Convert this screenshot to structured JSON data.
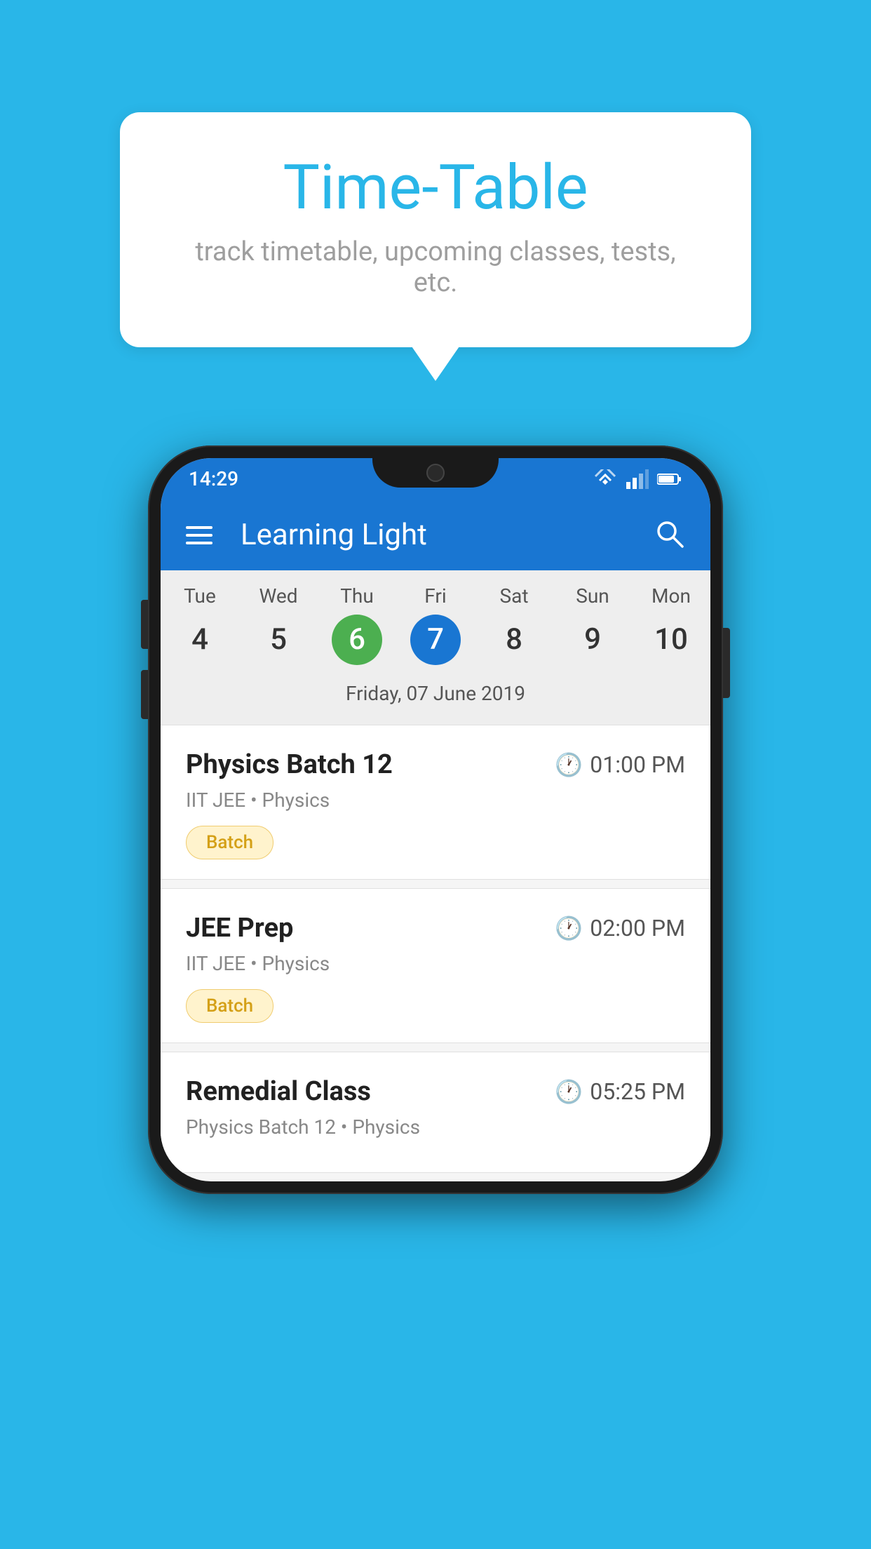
{
  "background_color": "#29B6E8",
  "tooltip": {
    "title": "Time-Table",
    "subtitle": "track timetable, upcoming classes, tests, etc."
  },
  "phone": {
    "status_bar": {
      "time": "14:29"
    },
    "app_bar": {
      "title": "Learning Light"
    },
    "calendar": {
      "days": [
        "Tue",
        "Wed",
        "Thu",
        "Fri",
        "Sat",
        "Sun",
        "Mon"
      ],
      "dates": [
        "4",
        "5",
        "6",
        "7",
        "8",
        "9",
        "10"
      ],
      "today_index": 2,
      "selected_index": 3,
      "selected_date_label": "Friday, 07 June 2019"
    },
    "classes": [
      {
        "name": "Physics Batch 12",
        "time": "01:00 PM",
        "info": "IIT JEE • Physics",
        "badge": "Batch"
      },
      {
        "name": "JEE Prep",
        "time": "02:00 PM",
        "info": "IIT JEE • Physics",
        "badge": "Batch"
      },
      {
        "name": "Remedial Class",
        "time": "05:25 PM",
        "info": "Physics Batch 12 • Physics",
        "badge": ""
      }
    ]
  }
}
